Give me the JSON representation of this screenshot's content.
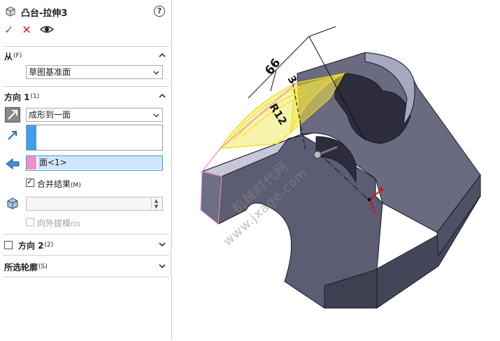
{
  "feature": {
    "title": "凸台-拉伸3"
  },
  "help_label": "?",
  "actions": {
    "ok": "✓",
    "cancel": "✕"
  },
  "from": {
    "label": "从",
    "shortcut": "(F)",
    "value": "草图基准面"
  },
  "direction1": {
    "label": "方向 1",
    "shortcut": "(1)",
    "end_condition": "成形到一面",
    "face_item": "面<1>",
    "merge_label": "合并结果",
    "merge_shortcut": "(M)",
    "merge_checked": true,
    "draft_label": "向外拔模",
    "draft_shortcut": "(O)",
    "draft_checked": false
  },
  "direction2": {
    "label": "方向 2",
    "shortcut": "(2)",
    "checked": false
  },
  "selected_contours": {
    "label": "所选轮廓",
    "shortcut": "(S)"
  },
  "viewport": {
    "dim_66": "66",
    "dim_3": "3",
    "dim_r12": "R12"
  },
  "watermark": {
    "cn": "机械时代网",
    "url": "www.jxage.com"
  },
  "colors": {
    "accent_blue": "#3f9ee8",
    "face_pink": "#f48cc8",
    "part_body": "#5a5a6e",
    "preview_yellow": "#f0e000",
    "ok_green": "#2a9a2a",
    "cancel_red": "#cc2222"
  }
}
